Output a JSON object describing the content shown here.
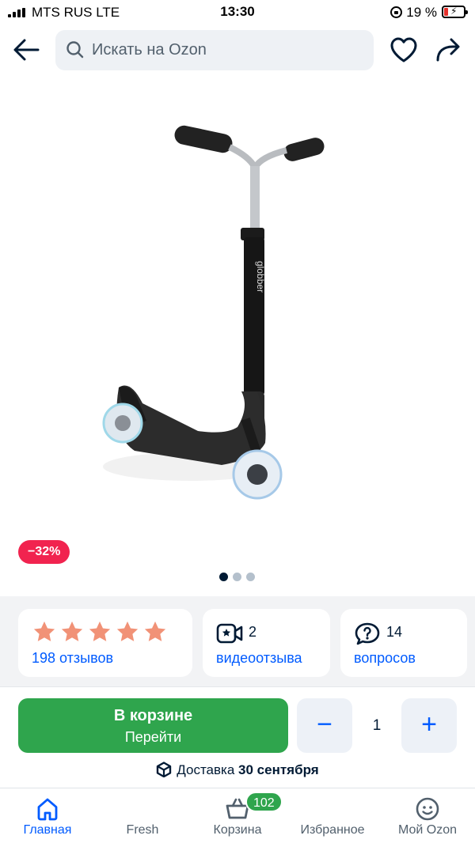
{
  "status_bar": {
    "carrier": "MTS RUS  LTE",
    "time": "13:30",
    "battery": "19 %"
  },
  "header": {
    "search_placeholder": "Искать на Ozon"
  },
  "product": {
    "discount_badge": "−32%",
    "gallery_pages": 3,
    "gallery_active": 1,
    "image_description": "kick-scooter-photo"
  },
  "stats": {
    "rating_stars": 5,
    "reviews_label": "198 отзывов",
    "videos_count": "2",
    "videos_label": "видеоотзыва",
    "questions_count": "14",
    "questions_label": "вопросов"
  },
  "buy": {
    "cart_title": "В корзине",
    "cart_sub": "Перейти",
    "minus": "−",
    "quantity": "1",
    "plus": "+",
    "delivery_prefix": "Доставка",
    "delivery_date": "30 сентября"
  },
  "tabbar": {
    "tabs": [
      {
        "label": "Главная",
        "icon": "home-icon",
        "active": true
      },
      {
        "label": "Fresh",
        "icon": "fresh-icon",
        "active": false
      },
      {
        "label": "Корзина",
        "icon": "cart-icon",
        "active": false,
        "badge": "102"
      },
      {
        "label": "Избранное",
        "icon": "heart-icon",
        "active": false
      },
      {
        "label": "Мой Ozon",
        "icon": "profile-icon",
        "active": false
      }
    ]
  },
  "colors": {
    "accent": "#005bff",
    "buy_green": "#2fa54d",
    "discount_red": "#f1234f",
    "star": "#f19277"
  }
}
